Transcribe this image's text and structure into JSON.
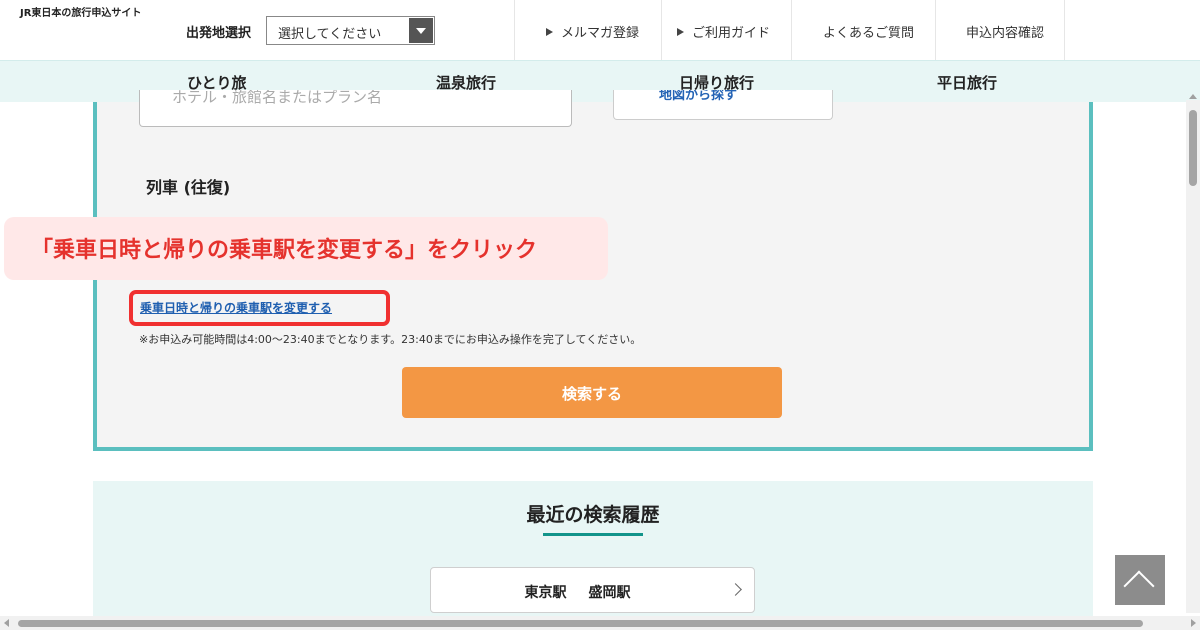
{
  "header": {
    "site_name": "JR東日本の旅行申込サイト",
    "origin_label": "出発地選択",
    "origin_select": {
      "value": "選択してください"
    },
    "nav": [
      {
        "label": "メルマガ登録",
        "icon": "triangle-right-icon"
      },
      {
        "label": "ご利用ガイド",
        "icon": "triangle-right-icon"
      },
      {
        "label": "よくあるご質問"
      },
      {
        "label": "申込内容確認"
      }
    ]
  },
  "categories": [
    "ひとり旅",
    "温泉旅行",
    "日帰り旅行",
    "平日旅行"
  ],
  "search_panel": {
    "hotel_placeholder": "ホテル・旅館名またはプラン名",
    "map_button_label": "地図から探す",
    "train_heading": "列車 (往復)",
    "change_link": "乗車日時と帰りの乗車駅を変更する",
    "note": "※お申込み可能時間は4:00〜23:40までとなります。23:40までにお申込み操作を完了してください。",
    "search_button": "検索する"
  },
  "callout": {
    "text": "「乗車日時と帰りの乗車駅を変更する」をクリック"
  },
  "history": {
    "title": "最近の検索履歴",
    "items": [
      {
        "from": "東京駅",
        "to": "盛岡駅"
      }
    ]
  },
  "colors": {
    "accent_teal": "#5bbfbf",
    "history_underline": "#12948a",
    "search_button": "#f39744",
    "callout_text": "#e5322d",
    "callout_bg": "#ffe8e8",
    "highlight_border": "#f03030",
    "link_blue": "#1f5fb0",
    "category_bar_bg": "#e8f6f5"
  }
}
